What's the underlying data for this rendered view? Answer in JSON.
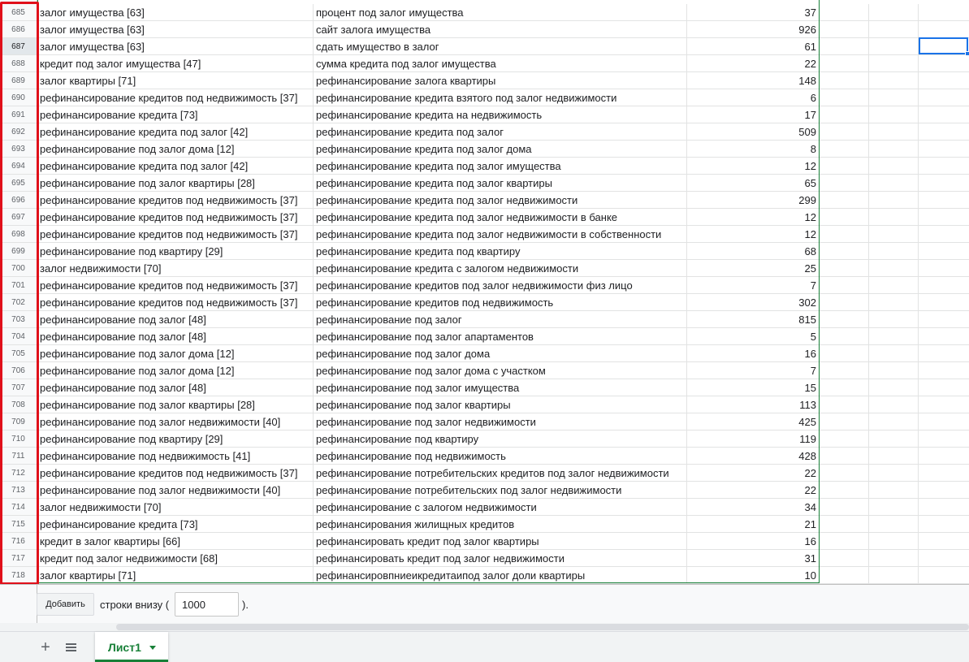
{
  "rows": [
    {
      "num": "685",
      "a": "залог имущества [63]",
      "b": "процент под залог имущества",
      "c": "37"
    },
    {
      "num": "686",
      "a": "залог имущества [63]",
      "b": "сайт залога имущества",
      "c": "926"
    },
    {
      "num": "687",
      "a": "залог имущества [63]",
      "b": "сдать имущество в залог",
      "c": "61"
    },
    {
      "num": "688",
      "a": "кредит под залог имущества [47]",
      "b": "сумма кредита под залог имущества",
      "c": "22"
    },
    {
      "num": "689",
      "a": "залог квартиры [71]",
      "b": "рефинансирование залога квартиры",
      "c": "148"
    },
    {
      "num": "690",
      "a": "рефинансирование кредитов под недвижимость [37]",
      "b": "рефинансирование кредита взятого под залог недвижимости",
      "c": "6"
    },
    {
      "num": "691",
      "a": "рефинансирование кредита [73]",
      "b": "рефинансирование кредита на недвижимость",
      "c": "17"
    },
    {
      "num": "692",
      "a": "рефинансирование кредита под залог [42]",
      "b": "рефинансирование кредита под залог",
      "c": "509"
    },
    {
      "num": "693",
      "a": "рефинансирование под залог дома [12]",
      "b": "рефинансирование кредита под залог дома",
      "c": "8"
    },
    {
      "num": "694",
      "a": "рефинансирование кредита под залог [42]",
      "b": "рефинансирование кредита под залог имущества",
      "c": "12"
    },
    {
      "num": "695",
      "a": "рефинансирование под залог квартиры [28]",
      "b": "рефинансирование кредита под залог квартиры",
      "c": "65"
    },
    {
      "num": "696",
      "a": "рефинансирование кредитов под недвижимость [37]",
      "b": "рефинансирование кредита под залог недвижимости",
      "c": "299"
    },
    {
      "num": "697",
      "a": "рефинансирование кредитов под недвижимость [37]",
      "b": "рефинансирование кредита под залог недвижимости в банке",
      "c": "12"
    },
    {
      "num": "698",
      "a": "рефинансирование кредитов под недвижимость [37]",
      "b": "рефинансирование кредита под залог недвижимости в собственности",
      "c": "12"
    },
    {
      "num": "699",
      "a": "рефинансирование под квартиру [29]",
      "b": "рефинансирование кредита под квартиру",
      "c": "68"
    },
    {
      "num": "700",
      "a": "залог недвижимости [70]",
      "b": "рефинансирование кредита с залогом недвижимости",
      "c": "25"
    },
    {
      "num": "701",
      "a": "рефинансирование кредитов под недвижимость [37]",
      "b": "рефинансирование кредитов под залог недвижимости физ лицо",
      "c": "7"
    },
    {
      "num": "702",
      "a": "рефинансирование кредитов под недвижимость [37]",
      "b": "рефинансирование кредитов под недвижимость",
      "c": "302"
    },
    {
      "num": "703",
      "a": "рефинансирование под залог [48]",
      "b": "рефинансирование под залог",
      "c": "815"
    },
    {
      "num": "704",
      "a": "рефинансирование под залог [48]",
      "b": "рефинансирование под залог апартаментов",
      "c": "5"
    },
    {
      "num": "705",
      "a": "рефинансирование под залог дома [12]",
      "b": "рефинансирование под залог дома",
      "c": "16"
    },
    {
      "num": "706",
      "a": "рефинансирование под залог дома [12]",
      "b": "рефинансирование под залог дома с участком",
      "c": "7"
    },
    {
      "num": "707",
      "a": "рефинансирование под залог [48]",
      "b": "рефинансирование под залог имущества",
      "c": "15"
    },
    {
      "num": "708",
      "a": "рефинансирование под залог квартиры [28]",
      "b": "рефинансирование под залог квартиры",
      "c": "113"
    },
    {
      "num": "709",
      "a": "рефинансирование под залог недвижимости [40]",
      "b": "рефинансирование под залог недвижимости",
      "c": "425"
    },
    {
      "num": "710",
      "a": "рефинансирование под квартиру [29]",
      "b": "рефинансирование под квартиру",
      "c": "119"
    },
    {
      "num": "711",
      "a": "рефинансирование под недвижимость [41]",
      "b": "рефинансирование под недвижимость",
      "c": "428"
    },
    {
      "num": "712",
      "a": "рефинансирование кредитов под недвижимость [37]",
      "b": "рефинансирование потребительских кредитов под залог недвижимости",
      "c": "22"
    },
    {
      "num": "713",
      "a": "рефинансирование под залог недвижимости [40]",
      "b": "рефинансирование потребительских под залог недвижимости",
      "c": "22"
    },
    {
      "num": "714",
      "a": "залог недвижимости [70]",
      "b": "рефинансирование с залогом недвижимости",
      "c": "34"
    },
    {
      "num": "715",
      "a": "рефинансирование кредита [73]",
      "b": "рефинансирования жилищных кредитов",
      "c": "21"
    },
    {
      "num": "716",
      "a": "кредит в залог квартиры [66]",
      "b": "рефинансировать кредит под залог квартиры",
      "c": "16"
    },
    {
      "num": "717",
      "a": "кредит под залог недвижимости [68]",
      "b": "рефинансировать кредит под залог недвижимости",
      "c": "31"
    },
    {
      "num": "718",
      "a": "залог квартиры [71]",
      "b": "рефинансировпниеикредитаипод залог доли квартиры",
      "c": "10"
    }
  ],
  "active_row": "687",
  "add_rows": {
    "button_label": "Добавить",
    "label": "строки внизу (",
    "value": "1000",
    "suffix": ")."
  },
  "tabs": {
    "add_icon": "+",
    "sheet_name": "Лист1"
  },
  "colors": {
    "accent_green": "#188038",
    "highlight_red": "#e0101a",
    "selection_blue": "#1a73e8"
  }
}
